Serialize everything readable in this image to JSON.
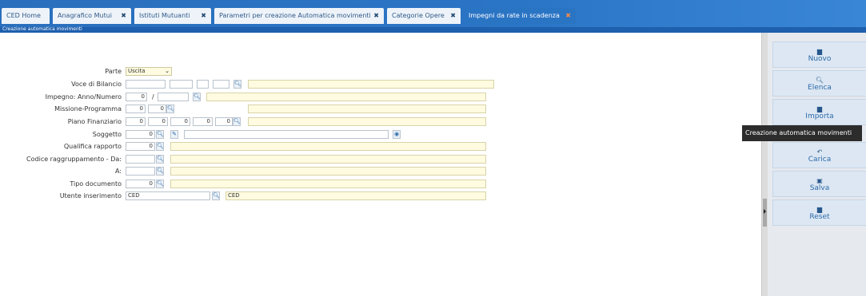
{
  "tabs": [
    {
      "label": "CED Home",
      "close": ""
    },
    {
      "label": "Anagrafico Mutui",
      "close": "✖"
    },
    {
      "label": "Istituti Mutuanti",
      "close": "✖"
    },
    {
      "label": "Parametri per creazione Automatica movimenti",
      "close": "✖"
    },
    {
      "label": "Categorie Opere",
      "close": "✖"
    },
    {
      "label": "Impegni da rate in scadenza",
      "close": "✖"
    }
  ],
  "subtitle": "Creazione automatica movimenti",
  "form": {
    "parte_label": "Parte",
    "parte_value": "Uscita",
    "voce_label": "Voce di Bilancio",
    "impegno_label": "Impegno: Anno/Numero",
    "impegno_anno": "0",
    "impegno_sep": "/",
    "missione_label": "Missione-Programma",
    "missione_1": "0",
    "missione_2": "0",
    "piano_label": "Piano Finanziario",
    "piano_1": "0",
    "piano_2": "0",
    "piano_3": "0",
    "piano_4": "0",
    "piano_5": "0",
    "soggetto_label": "Soggetto",
    "soggetto_value": "0",
    "qualifica_label": "Qualifica rapporto",
    "qualifica_value": "0",
    "codice_da_label": "Codice raggruppamento - Da:",
    "codice_a_label": "A:",
    "tipo_doc_label": "Tipo documento",
    "tipo_doc_value": "0",
    "utente_label": "Utente inserimento",
    "utente_value": "CED",
    "utente_desc": "CED"
  },
  "actions": [
    {
      "label": "Nuovo",
      "icon": "new-file-icon",
      "glyph": "▆"
    },
    {
      "label": "Elenca",
      "icon": "search-icon",
      "glyph": "🔍︎"
    },
    {
      "label": "Importa",
      "icon": "import-icon",
      "glyph": "▆"
    },
    {
      "label": "Carica",
      "icon": "load-icon",
      "glyph": "↶"
    },
    {
      "label": "Salva",
      "icon": "save-icon",
      "glyph": "▣"
    },
    {
      "label": "Reset",
      "icon": "reset-icon",
      "glyph": "▆"
    }
  ],
  "tooltip": "Creazione automatica movimenti",
  "colors": {
    "accent": "#2a74c4",
    "active_close": "#f08a4b",
    "field_yellow": "#fffbe0"
  }
}
